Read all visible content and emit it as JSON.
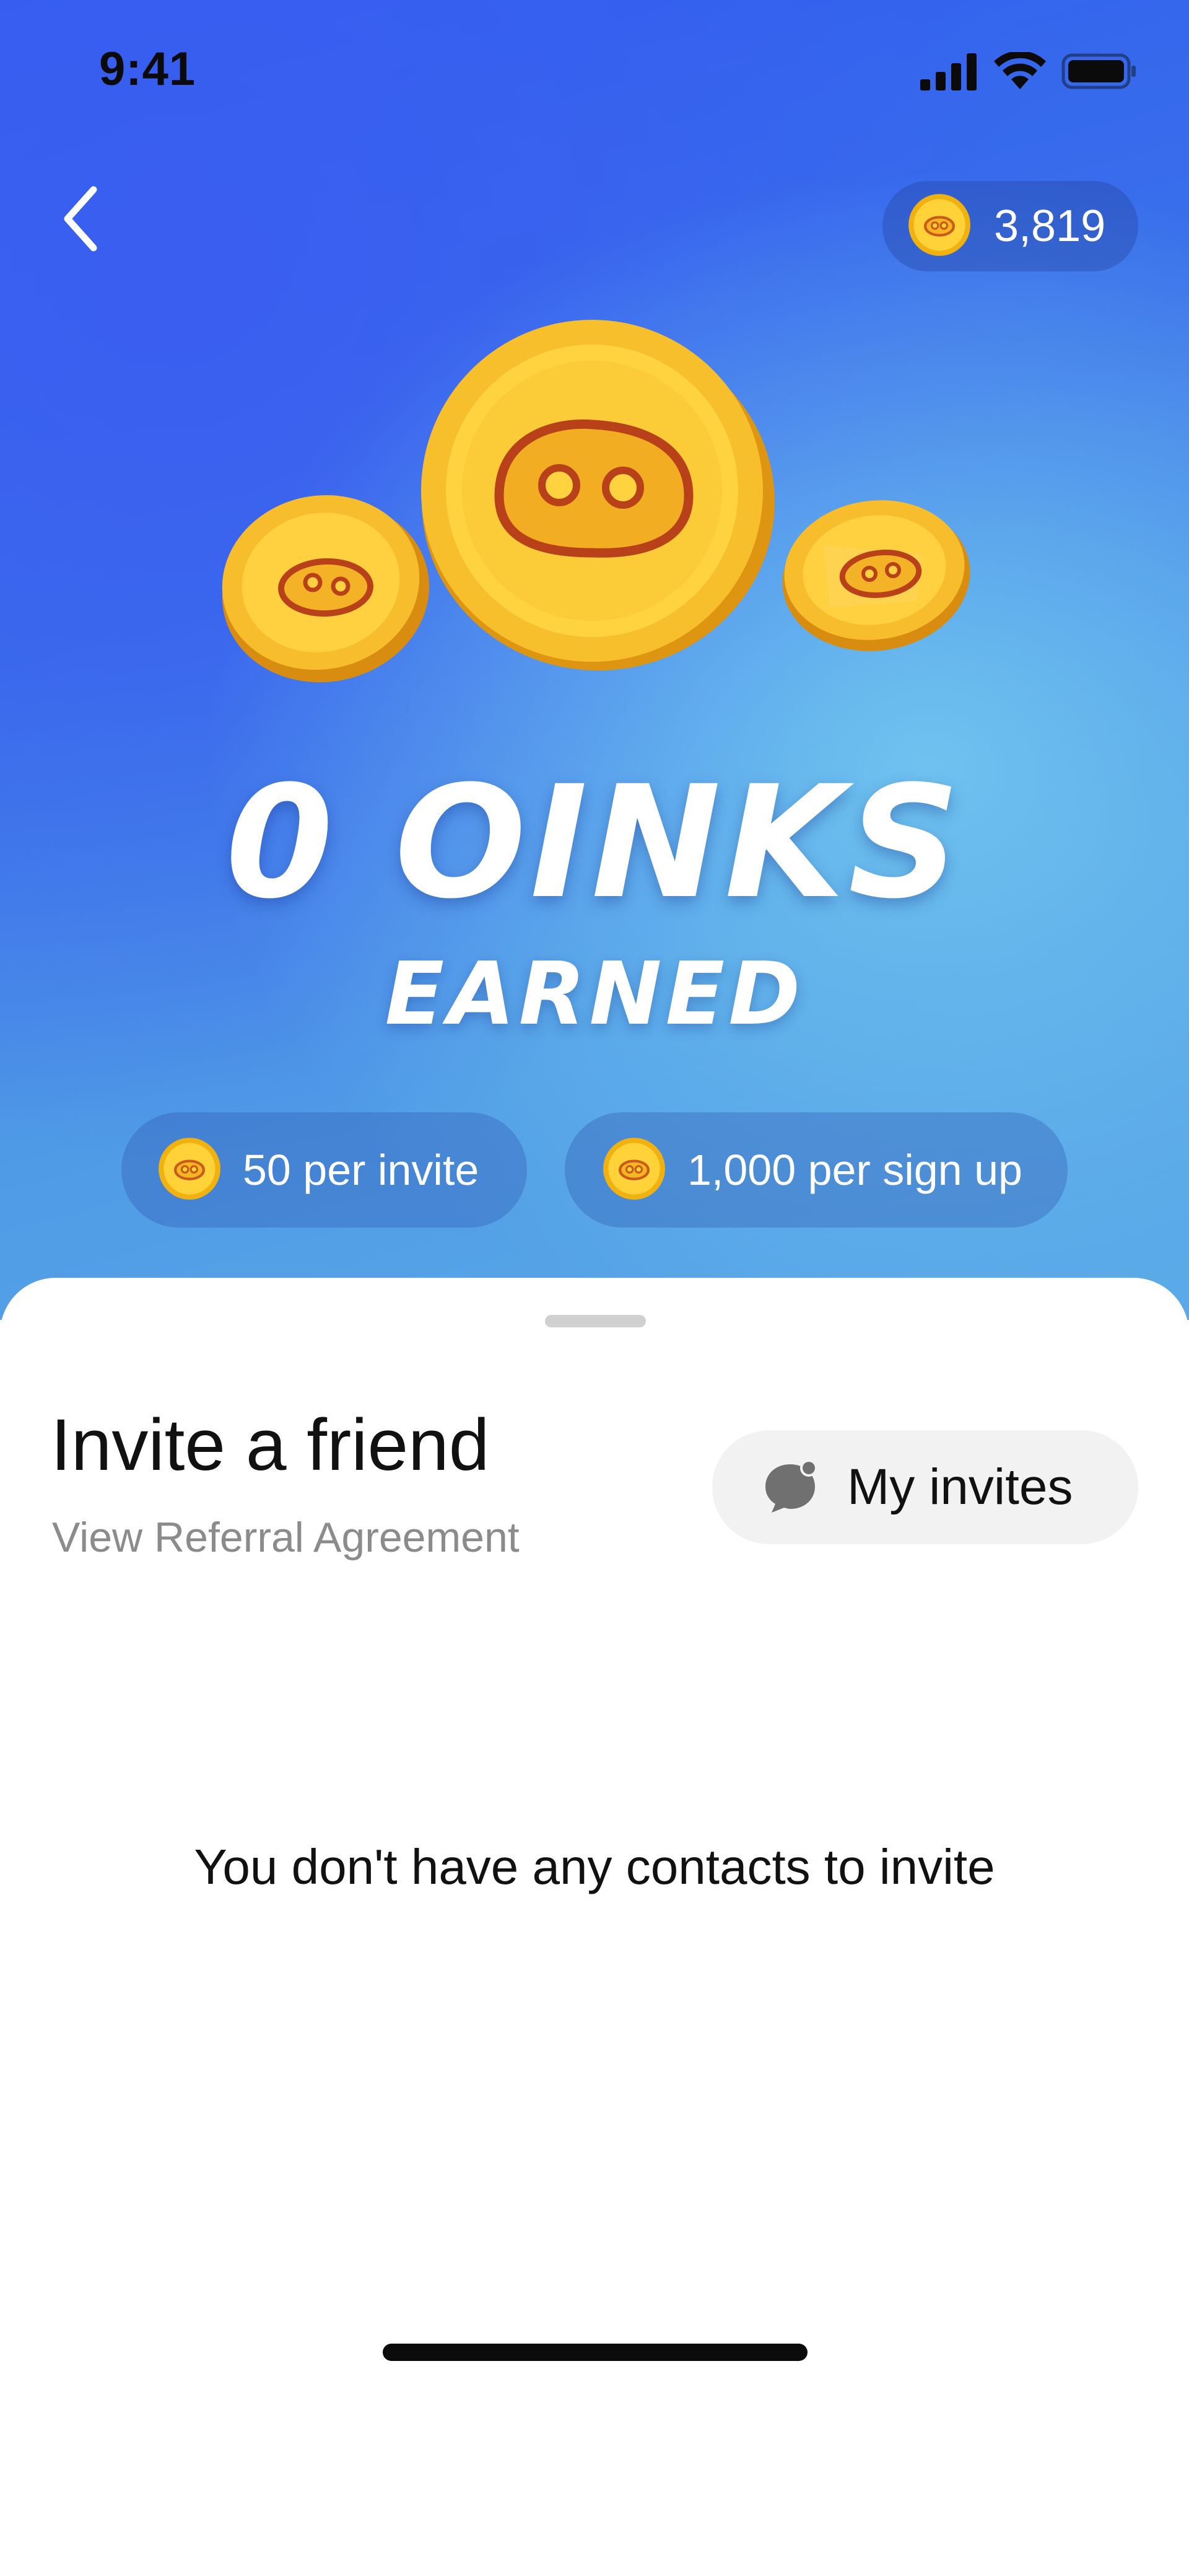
{
  "status_bar": {
    "time": "9:41",
    "icons": [
      "cellular-signal-icon",
      "wifi-icon",
      "battery-icon"
    ]
  },
  "header": {
    "back_icon": "chevron-left-icon",
    "balance": {
      "icon": "oink-coin-icon",
      "value": "3,819"
    }
  },
  "hero": {
    "headline": "0 OINKS",
    "subheadline": "EARNED",
    "rewards": [
      {
        "icon": "oink-coin-icon",
        "label": "50 per invite"
      },
      {
        "icon": "oink-coin-icon",
        "label": "1,000 per sign up"
      }
    ]
  },
  "sheet": {
    "title": "Invite a friend",
    "agreement_link": "View Referral Agreement",
    "my_invites_button": {
      "icon": "chat-bubble-icon",
      "label": "My invites"
    },
    "empty_state": "You don't have any contacts to invite"
  },
  "colors": {
    "hero_blue": "#3b72ea",
    "hero_light_blue": "#6fc2ef",
    "coin_gold": "#f5c431",
    "coin_dark": "#e59a10",
    "coin_nose": "#b8411a",
    "sheet_bg": "#ffffff",
    "button_gray": "#f2f2f2",
    "muted_text": "#8b8b8b"
  }
}
